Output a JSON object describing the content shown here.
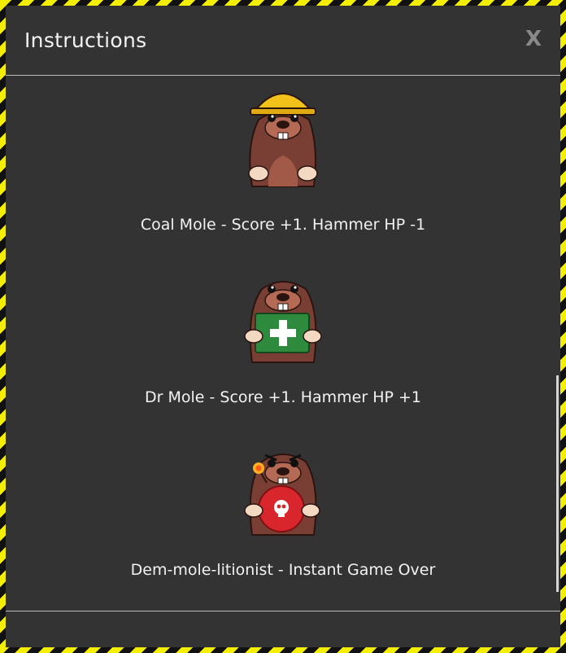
{
  "dialog": {
    "title": "Instructions",
    "close_label": "X"
  },
  "moles": [
    {
      "name": "coal-mole",
      "icon": "hard-hat-mole-icon",
      "description": "Coal Mole - Score +1. Hammer HP -1"
    },
    {
      "name": "dr-mole",
      "icon": "first-aid-mole-icon",
      "description": "Dr Mole - Score +1. Hammer HP +1"
    },
    {
      "name": "dem-mole-litionist",
      "icon": "bomb-mole-icon",
      "description": "Dem-mole-litionist - Instant Game Over"
    }
  ],
  "colors": {
    "hazard_yellow": "#f4ef00",
    "panel": "#333333",
    "text": "#f2f2f2",
    "mole_brown": "#7a3f34",
    "helmet": "#f2c21b",
    "medkit": "#2e8b3e",
    "bomb": "#d9262c"
  }
}
